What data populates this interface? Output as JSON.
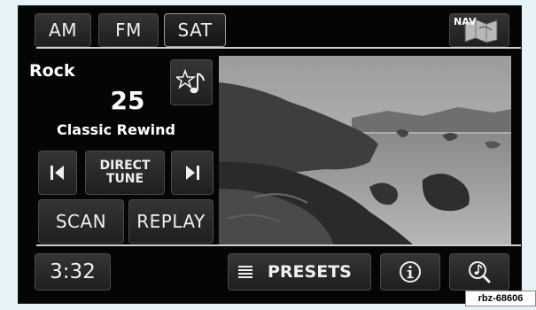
{
  "bands": [
    {
      "label": "AM",
      "active": false
    },
    {
      "label": "FM",
      "active": false
    },
    {
      "label": "SAT",
      "active": true
    }
  ],
  "nav": {
    "label": "NAV"
  },
  "station": {
    "genre": "Rock",
    "channel": "25",
    "name": "Classic Rewind"
  },
  "controls": {
    "direct_tune": "DIRECT TUNE",
    "direct_tune_line1": "DIRECT",
    "direct_tune_line2": "TUNE",
    "scan": "SCAN",
    "replay": "REPLAY"
  },
  "bottom": {
    "time": "3:32",
    "presets": "PRESETS"
  },
  "reference_tag": "rbz-68606",
  "icons": {
    "favorite": "star-music-note-icon",
    "seek_back": "skip-back-icon",
    "seek_forward": "skip-forward-icon",
    "presets_list": "list-icon",
    "info": "info-icon",
    "music_search": "music-search-icon",
    "nav_map": "map-icon"
  }
}
